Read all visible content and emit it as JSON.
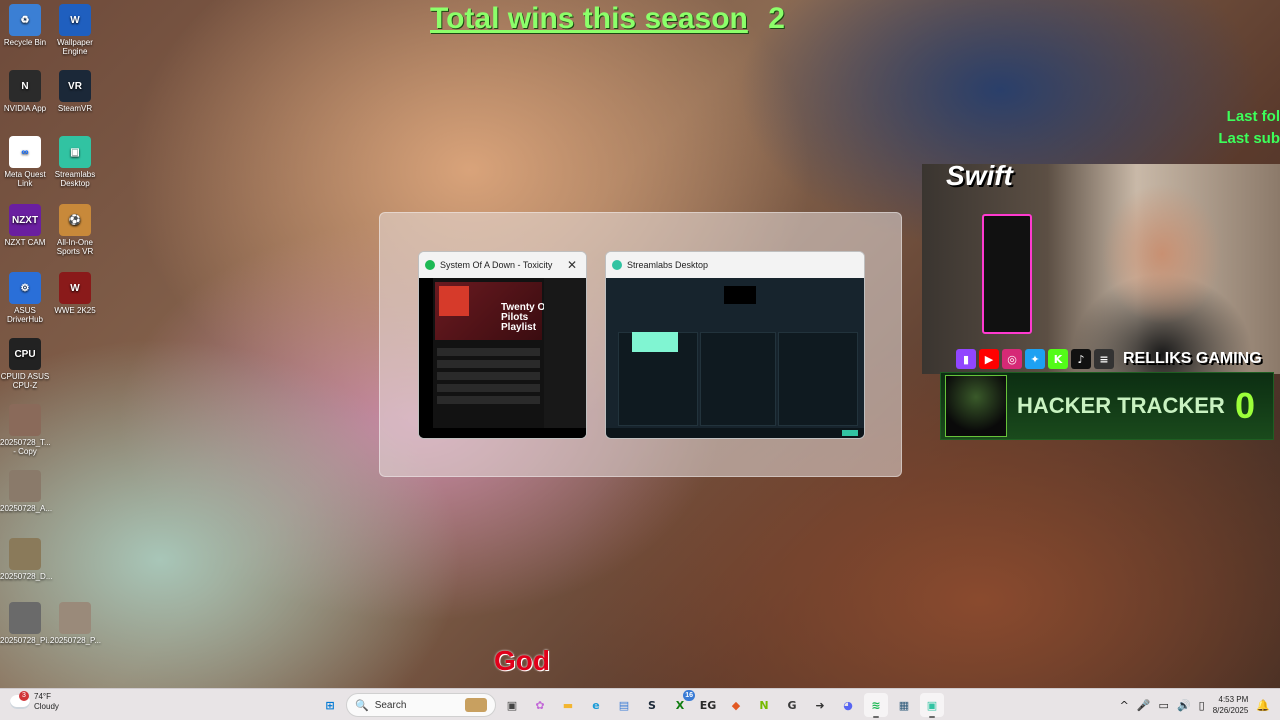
{
  "desktop_icons": [
    {
      "label": "Recycle Bin",
      "icon": "recycle-bin-icon",
      "color": "#3b7fd4",
      "glyph": "♻"
    },
    {
      "label": "Wallpaper Engine",
      "icon": "wallpaper-engine-icon",
      "color": "#1f5fbf",
      "glyph": "W"
    },
    {
      "label": "NVIDIA App",
      "icon": "nvidia-icon",
      "color": "#2b2b2b",
      "glyph": "N"
    },
    {
      "label": "SteamVR",
      "icon": "steamvr-icon",
      "color": "#1b2838",
      "glyph": "VR"
    },
    {
      "label": "Meta Quest Link",
      "icon": "meta-quest-icon",
      "color": "#ffffff",
      "glyph": "∞"
    },
    {
      "label": "Streamlabs Desktop",
      "icon": "streamlabs-icon",
      "color": "#31c3a2",
      "glyph": "▣"
    },
    {
      "label": "NZXT CAM",
      "icon": "nzxt-cam-icon",
      "color": "#6a1fa0",
      "glyph": "NZXT"
    },
    {
      "label": "All-In-One Sports VR",
      "icon": "sports-vr-icon",
      "color": "#c8893a",
      "glyph": "⚽"
    },
    {
      "label": "ASUS DriverHub",
      "icon": "asus-driverhub-icon",
      "color": "#2a6fd8",
      "glyph": "⚙"
    },
    {
      "label": "WWE 2K25",
      "icon": "wwe-2k25-icon",
      "color": "#8a1a1a",
      "glyph": "W"
    },
    {
      "label": "CPUID ASUS CPU-Z",
      "icon": "cpu-z-icon",
      "color": "#222222",
      "glyph": "CPU"
    },
    {
      "label": "20250728_T... - Copy",
      "icon": "image-file-icon",
      "color": "#8a6a5a",
      "glyph": ""
    },
    {
      "label": "20250728_A...",
      "icon": "image-file-icon",
      "color": "#8a7a6a",
      "glyph": ""
    },
    {
      "label": "20250728_D...",
      "icon": "image-file-icon",
      "color": "#8a7a5a",
      "glyph": ""
    },
    {
      "label": "20250728_Pi...",
      "icon": "image-file-icon",
      "color": "#6a6a6a",
      "glyph": ""
    },
    {
      "label": "20250728_P...",
      "icon": "image-file-icon",
      "color": "#9a8a7a",
      "glyph": ""
    }
  ],
  "overlay": {
    "wins_label": "Total wins this season",
    "wins_count": "2",
    "last_follow": "Last fol",
    "last_sub": "Last sub",
    "swift_text": "Swift",
    "channel_name": "RELLIKS GAMING",
    "hacker_label": "HACKER TRACKER",
    "hacker_count": "0",
    "caption": "God",
    "socials": [
      {
        "icon": "twitch-icon",
        "color": "#9146ff",
        "glyph": "▮"
      },
      {
        "icon": "youtube-icon",
        "color": "#ff0000",
        "glyph": "▶"
      },
      {
        "icon": "instagram-icon",
        "color": "#d62976",
        "glyph": "◎"
      },
      {
        "icon": "twitter-icon",
        "color": "#1da1f2",
        "glyph": "✦"
      },
      {
        "icon": "kick-icon",
        "color": "#53fc18",
        "glyph": "K"
      },
      {
        "icon": "tiktok-icon",
        "color": "#111111",
        "glyph": "♪"
      },
      {
        "icon": "linktree-icon",
        "color": "#333333",
        "glyph": "≡"
      }
    ]
  },
  "switcher": {
    "windows": [
      {
        "title": "System Of A Down - Toxicity",
        "app_icon": "spotify-icon",
        "color": "#1db954",
        "playlist_title": "Twenty One Pilots Playlist"
      },
      {
        "title": "Streamlabs Desktop",
        "app_icon": "streamlabs-icon",
        "color": "#31c3a2"
      }
    ],
    "close_glyph": "✕"
  },
  "taskbar": {
    "weather_temp": "74°F",
    "weather_desc": "Cloudy",
    "weather_badge": "3",
    "search_label": "Search",
    "search_glyph": "🔍",
    "apps": [
      {
        "name": "start-button",
        "icon": "windows-start-icon",
        "color": "#0078d4",
        "glyph": "⊞"
      },
      {
        "name": "taskbar-task-view",
        "icon": "task-view-icon",
        "color": "#444444",
        "glyph": "▣"
      },
      {
        "name": "taskbar-copilot",
        "icon": "copilot-icon",
        "color": "#c36ad8",
        "glyph": "✿"
      },
      {
        "name": "taskbar-file-explorer",
        "icon": "folder-icon",
        "color": "#f3b530",
        "glyph": "▬"
      },
      {
        "name": "taskbar-edge",
        "icon": "edge-icon",
        "color": "#1a9bd8",
        "glyph": "e"
      },
      {
        "name": "taskbar-store",
        "icon": "store-icon",
        "color": "#3a7bd5",
        "glyph": "▤"
      },
      {
        "name": "taskbar-steam",
        "icon": "steam-icon",
        "color": "#1b2838",
        "glyph": "S"
      },
      {
        "name": "taskbar-xbox",
        "icon": "xbox-icon",
        "color": "#107c10",
        "glyph": "X",
        "badge": "16"
      },
      {
        "name": "taskbar-epic",
        "icon": "epic-games-icon",
        "color": "#2a2a2a",
        "glyph": "EG"
      },
      {
        "name": "taskbar-brave",
        "icon": "browser-icon",
        "color": "#e25822",
        "glyph": "◆"
      },
      {
        "name": "taskbar-nvidia",
        "icon": "nvidia-icon",
        "color": "#76b900",
        "glyph": "N"
      },
      {
        "name": "taskbar-gameapp",
        "icon": "game-app-icon",
        "color": "#3a3a3a",
        "glyph": "G"
      },
      {
        "name": "taskbar-app-arrow",
        "icon": "app-arrow-icon",
        "color": "#333333",
        "glyph": "➜"
      },
      {
        "name": "taskbar-discord",
        "icon": "discord-icon",
        "color": "#5865f2",
        "glyph": "◕"
      },
      {
        "name": "taskbar-spotify",
        "icon": "spotify-icon",
        "color": "#1db954",
        "glyph": "≋",
        "active": true
      },
      {
        "name": "taskbar-app-2",
        "icon": "app-icon",
        "color": "#2d5a7a",
        "glyph": "▦"
      },
      {
        "name": "taskbar-streamlabs",
        "icon": "streamlabs-icon",
        "color": "#31c3a2",
        "glyph": "▣",
        "active": true
      }
    ],
    "tray": [
      {
        "icon": "chevron-up-icon",
        "glyph": "^"
      },
      {
        "icon": "microphone-icon",
        "glyph": "🎤"
      },
      {
        "icon": "network-icon",
        "glyph": "▭"
      },
      {
        "icon": "volume-icon",
        "glyph": "🔊"
      },
      {
        "icon": "battery-icon",
        "glyph": "▯"
      }
    ],
    "time": "4:53 PM",
    "date": "8/26/2025",
    "bell_glyph": "🔔"
  }
}
